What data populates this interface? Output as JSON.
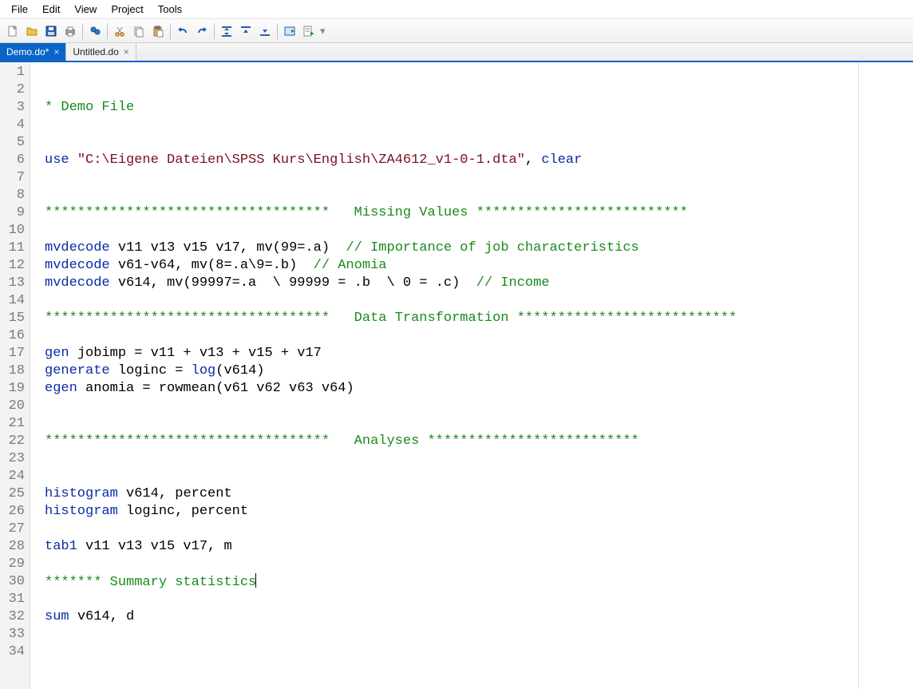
{
  "menu": {
    "file": "File",
    "edit": "Edit",
    "view": "View",
    "project": "Project",
    "tools": "Tools"
  },
  "toolbar": {
    "new": "new-file-icon",
    "open": "open-folder-icon",
    "save": "save-icon",
    "print": "print-icon",
    "find": "find-icon",
    "cut": "cut-icon",
    "copy": "copy-icon",
    "paste": "paste-icon",
    "undo": "undo-icon",
    "redo": "redo-icon",
    "indent": "indent-toggle-icon",
    "unindent": "unindent-icon",
    "bookmark": "bookmark-next-icon",
    "run": "run-icon",
    "run_lines": "run-lines-icon"
  },
  "tabs": [
    {
      "label": "Demo.do*",
      "active": true
    },
    {
      "label": "Untitled.do",
      "active": false
    }
  ],
  "code": {
    "lines": [
      {
        "n": 1,
        "segs": []
      },
      {
        "n": 2,
        "segs": []
      },
      {
        "n": 3,
        "segs": [
          {
            "t": "* Demo File",
            "c": "cmt"
          }
        ]
      },
      {
        "n": 4,
        "segs": []
      },
      {
        "n": 5,
        "segs": []
      },
      {
        "n": 6,
        "segs": [
          {
            "t": "use ",
            "c": "kw"
          },
          {
            "t": "\"C:\\Eigene Dateien\\SPSS Kurs\\English\\ZA4612_v1-0-1.dta\"",
            "c": "str"
          },
          {
            "t": ", "
          },
          {
            "t": "clear",
            "c": "kw"
          }
        ]
      },
      {
        "n": 7,
        "segs": []
      },
      {
        "n": 8,
        "segs": []
      },
      {
        "n": 9,
        "segs": [
          {
            "t": "***********************************   Missing Values **************************",
            "c": "cmt"
          }
        ]
      },
      {
        "n": 10,
        "segs": []
      },
      {
        "n": 11,
        "segs": [
          {
            "t": "mvdecode ",
            "c": "kw"
          },
          {
            "t": "v11 v13 v15 v17, mv(99=.a)  "
          },
          {
            "t": "// Importance of job characteristics",
            "c": "cmt"
          }
        ]
      },
      {
        "n": 12,
        "segs": [
          {
            "t": "mvdecode ",
            "c": "kw"
          },
          {
            "t": "v61-v64, mv(8=.a\\9=.b)  "
          },
          {
            "t": "// Anomia",
            "c": "cmt"
          }
        ]
      },
      {
        "n": 13,
        "segs": [
          {
            "t": "mvdecode ",
            "c": "kw"
          },
          {
            "t": "v614, mv(99997=.a  \\ 99999 = .b  \\ 0 = .c)  "
          },
          {
            "t": "// Income",
            "c": "cmt"
          }
        ]
      },
      {
        "n": 14,
        "segs": []
      },
      {
        "n": 15,
        "segs": [
          {
            "t": "***********************************   Data Transformation ***************************",
            "c": "cmt"
          }
        ]
      },
      {
        "n": 16,
        "segs": []
      },
      {
        "n": 17,
        "segs": [
          {
            "t": "gen ",
            "c": "kw"
          },
          {
            "t": "jobimp = v11 + v13 + v15 + v17"
          }
        ]
      },
      {
        "n": 18,
        "segs": [
          {
            "t": "generate ",
            "c": "kw"
          },
          {
            "t": "loginc = "
          },
          {
            "t": "log",
            "c": "fn"
          },
          {
            "t": "(v614)"
          }
        ]
      },
      {
        "n": 19,
        "segs": [
          {
            "t": "egen ",
            "c": "kw"
          },
          {
            "t": "anomia = rowmean(v61 v62 v63 v64)"
          }
        ]
      },
      {
        "n": 20,
        "segs": []
      },
      {
        "n": 21,
        "segs": []
      },
      {
        "n": 22,
        "segs": [
          {
            "t": "***********************************   Analyses **************************",
            "c": "cmt"
          }
        ]
      },
      {
        "n": 23,
        "segs": []
      },
      {
        "n": 24,
        "segs": []
      },
      {
        "n": 25,
        "segs": [
          {
            "t": "histogram ",
            "c": "kw"
          },
          {
            "t": "v614, percent"
          }
        ]
      },
      {
        "n": 26,
        "segs": [
          {
            "t": "histogram ",
            "c": "kw"
          },
          {
            "t": "loginc, percent"
          }
        ]
      },
      {
        "n": 27,
        "segs": []
      },
      {
        "n": 28,
        "segs": [
          {
            "t": "tab1 ",
            "c": "kw"
          },
          {
            "t": "v11 v13 v15 v17, m"
          }
        ]
      },
      {
        "n": 29,
        "segs": []
      },
      {
        "n": 30,
        "segs": [
          {
            "t": "******* Summary statistics",
            "c": "cmt",
            "caret": true
          }
        ]
      },
      {
        "n": 31,
        "segs": []
      },
      {
        "n": 32,
        "segs": [
          {
            "t": "sum ",
            "c": "kw"
          },
          {
            "t": "v614, d"
          }
        ]
      },
      {
        "n": 33,
        "segs": []
      },
      {
        "n": 34,
        "segs": []
      }
    ]
  }
}
